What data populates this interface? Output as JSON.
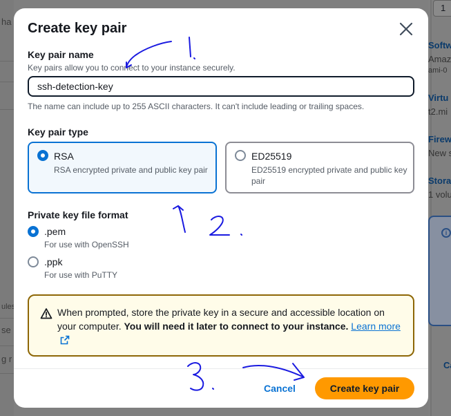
{
  "background": {
    "left_fragments": [
      "ha",
      "ules",
      "se",
      "g r"
    ],
    "right_fragments": [
      "1",
      "Softw",
      "Amaz",
      "ami-0",
      "Virtu",
      "t2.mi",
      "Firew",
      "New s",
      "Stora",
      "1 volu",
      "Ca"
    ]
  },
  "modal": {
    "title": "Create key pair",
    "key_name": {
      "label": "Key pair name",
      "description": "Key pairs allow you to connect to your instance securely.",
      "value": "ssh-detection-key",
      "constraint": "The name can include up to 255 ASCII characters. It can't include leading or trailing spaces."
    },
    "key_type": {
      "label": "Key pair type",
      "options": [
        {
          "name": "RSA",
          "description": "RSA encrypted private and public key pair",
          "selected": true
        },
        {
          "name": "ED25519",
          "description": "ED25519 encrypted private and public key pair",
          "selected": false
        }
      ]
    },
    "file_format": {
      "label": "Private key file format",
      "options": [
        {
          "name": ".pem",
          "description": "For use with OpenSSH",
          "selected": true
        },
        {
          "name": ".ppk",
          "description": "For use with PuTTY",
          "selected": false
        }
      ]
    },
    "alert": {
      "text": "When prompted, store the private key in a secure and accessible location on your computer. ",
      "bold": "You will need it later to connect to your instance.",
      "link": "Learn more"
    },
    "buttons": {
      "cancel": "Cancel",
      "create": "Create key pair"
    }
  },
  "colors": {
    "accent": "#0972d3",
    "primary_button": "#ff9900",
    "warning_border": "#8d6605",
    "warning_bg": "#fffce9",
    "annotation_ink": "#1a1ae0"
  }
}
